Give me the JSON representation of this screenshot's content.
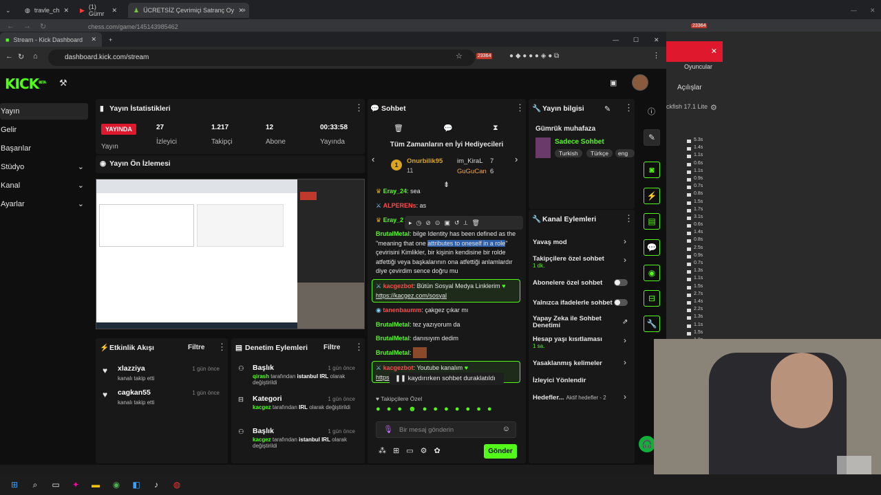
{
  "outer_browser": {
    "tabs": [
      "travle_ch",
      "(1) Gümr",
      "ÜCRETSİZ Çevrimiçi Satranç Oy"
    ],
    "url": "chess.com/game/145143985462",
    "badge": "23364"
  },
  "inner_browser": {
    "tab_title": "Stream - Kick Dashboard",
    "url": "dashboard.kick.com/stream",
    "badge": "23364"
  },
  "kick": {
    "logo": "KICK",
    "logo_badge": "BETA",
    "nav": [
      "Yayın",
      "Gelir",
      "Başarılar",
      "Stüdyo",
      "Kanal",
      "Ayarlar"
    ]
  },
  "stats": {
    "title": "Yayın İstatistikleri",
    "live_badge": "YAYINDA",
    "items": [
      {
        "value": "27",
        "label": "İzleyici"
      },
      {
        "value": "1.217",
        "label": "Takipçi"
      },
      {
        "value": "12",
        "label": "Abone"
      },
      {
        "value": "00:33:58",
        "label": "Yayında"
      }
    ],
    "status_label": "Yayın"
  },
  "preview": {
    "title": "Yayın Ön İzlemesi"
  },
  "activity": {
    "title": "Etkinlik Akışı",
    "filter": "Filtre",
    "items": [
      {
        "user": "xlazziya",
        "text": "kanalı takip etti",
        "time": "1 gün önce"
      },
      {
        "user": "cagkan55",
        "text": "kanalı takip etti",
        "time": "1 gün önce"
      }
    ]
  },
  "moderation": {
    "title": "Denetim Eylemleri",
    "filter": "Filtre",
    "items": [
      {
        "title": "Başlık",
        "who": "qirash",
        "mid": " tarafından ",
        "val": "istanbul IRL",
        "end": " olarak değiştirildi",
        "time": "1 gün önce"
      },
      {
        "title": "Kategori",
        "who": "kacgez",
        "mid": " tarafından ",
        "val": "IRL",
        "end": " olarak değiştirildi",
        "time": "1 gün önce"
      },
      {
        "title": "Başlık",
        "who": "kacgez",
        "mid": " tarafından ",
        "val": "istanbul IRL",
        "end": " olarak değiştirildi",
        "time": "1 gün önce"
      }
    ]
  },
  "chat": {
    "title": "Sohbet",
    "gifters_title": "Tüm Zamanların en İyi Hediyecileri",
    "gifters": [
      {
        "name": "Onurbilik95",
        "count": "11"
      },
      {
        "name": "im_KiraL",
        "count": "7"
      },
      {
        "name": "GuGuCan",
        "count": "6"
      }
    ],
    "rank": "1",
    "messages": [
      {
        "user": "Eray_24",
        "text": "sea"
      },
      {
        "user": "ALPERENs",
        "text": "as"
      },
      {
        "user": "Eray_2",
        "text": ""
      },
      {
        "user": "BrutalMetal",
        "pre": "bilge Identity has been defined as the \"meaning that one ",
        "sel": "attributes to oneself in a role",
        "post": "\" çevirisini Kimlikler, bir kişinin kendisine bir rolde atfettiği veya başkalarının ona atfettiği anlamlardır diye çevirdim sence doğru mu"
      },
      {
        "user": "kacgezbot",
        "text": "Bütün Sosyal Medya Linklerim",
        "link": "https://kacgez.com/sosyal"
      },
      {
        "user": "tanenbaumm",
        "text": "çakgez çıkar mı"
      },
      {
        "user": "BrutalMetal",
        "text": "tez yazıyorum da"
      },
      {
        "user": "BrutalMetal",
        "text": "danısıyım dedim"
      },
      {
        "user": "BrutalMetal",
        "text": ""
      },
      {
        "user": "kacgezbot",
        "text": "Youtube kanalım",
        "link": "https"
      }
    ],
    "paused": "kaydırırken sohbet duraklatıldı",
    "followers_only": "Takipçilere Özel",
    "input_placeholder": "Bir mesaj gönderin",
    "send": "Gönder"
  },
  "stream_info": {
    "title": "Yayın bilgisi",
    "stream_title": "Gümrük muhafaza",
    "category": "Sadece Sohbet",
    "tags": [
      "Turkish",
      "Türkçe",
      "eng"
    ]
  },
  "channel_actions": {
    "title": "Kanal Eylemleri",
    "items": [
      {
        "label": "Yavaş mod",
        "kind": "arrow"
      },
      {
        "label": "Takipçilere özel sohbet",
        "sub": "1 dk.",
        "kind": "arrow"
      },
      {
        "label": "Abonelere özel sohbet",
        "kind": "toggle"
      },
      {
        "label": "Yalnızca ifadelerle sohbet",
        "kind": "toggle"
      },
      {
        "label": "Yapay Zeka ile Sohbet Denetimi",
        "kind": "ext"
      },
      {
        "label": "Hesap yaşı kısıtlaması",
        "sub": "1 sa.",
        "kind": "arrow"
      },
      {
        "label": "Yasaklanmış kelimeler",
        "kind": "arrow"
      },
      {
        "label": "İzleyici Yönlendir",
        "kind": "none"
      },
      {
        "label": "Hedefler...",
        "sub": "Aktif hedefler - 2",
        "kind": "arrow"
      }
    ]
  },
  "right_panel": {
    "players": "Oyuncular",
    "openings": "Açılışlar",
    "engine": "ckfish 17.1 Lite",
    "eval_values": [
      "5.3s",
      "1.4s",
      "1.1s",
      "0.6s",
      "1.1s",
      "0.9s",
      "0.7s",
      "0.8s",
      "1.5s",
      "1.7s",
      "3.1s",
      "0.6s",
      "1.4s",
      "0.8s",
      "2.5s",
      "0.9s",
      "0.7s",
      "1.3s",
      "1.1s",
      "1.5s",
      "2.7s",
      "1.4s",
      "2.2s",
      "1.3s",
      "1.1s",
      "1.5s",
      "1.8s",
      "1.1s"
    ]
  },
  "colors": {
    "accent": "#53fc18",
    "live": "#e0182d"
  }
}
